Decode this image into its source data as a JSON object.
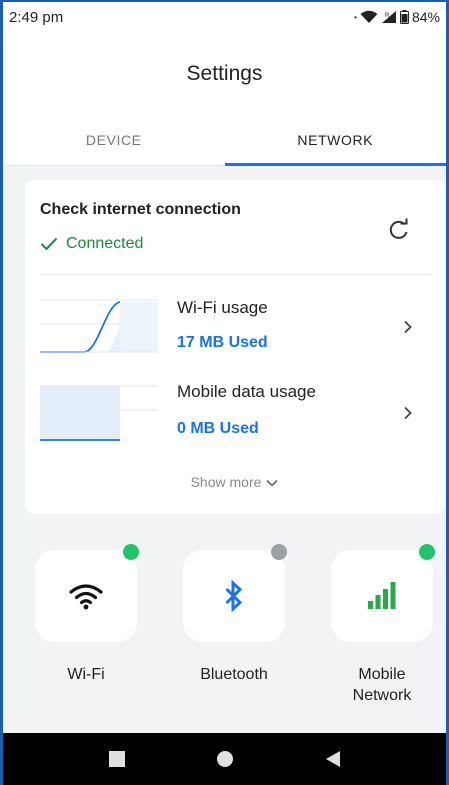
{
  "status_bar": {
    "time": "2:49 pm",
    "battery": "84%"
  },
  "header": {
    "title": "Settings"
  },
  "tabs": [
    {
      "label": "DEVICE",
      "active": false
    },
    {
      "label": "NETWORK",
      "active": true
    }
  ],
  "connection_card": {
    "title": "Check internet connection",
    "status": "Connected",
    "status_color": "#1b8a3a"
  },
  "usage": [
    {
      "label": "Wi-Fi usage",
      "value": "17 MB Used"
    },
    {
      "label": "Mobile data usage",
      "value": "0 MB Used"
    }
  ],
  "show_more": "Show more",
  "tiles": [
    {
      "label": "Wi-Fi",
      "icon": "wifi-icon",
      "status_dot_color": "#20c56a"
    },
    {
      "label": "Bluetooth",
      "icon": "bluetooth-icon",
      "status_dot_color": "#9aa0a6"
    },
    {
      "label": "Mobile Network",
      "label_line1": "Mobile",
      "label_line2": "Network",
      "icon": "signal-bars-icon",
      "status_dot_color": "#20c56a"
    }
  ],
  "colors": {
    "accent": "#1a73e8",
    "frame": "#1a5fb4"
  }
}
